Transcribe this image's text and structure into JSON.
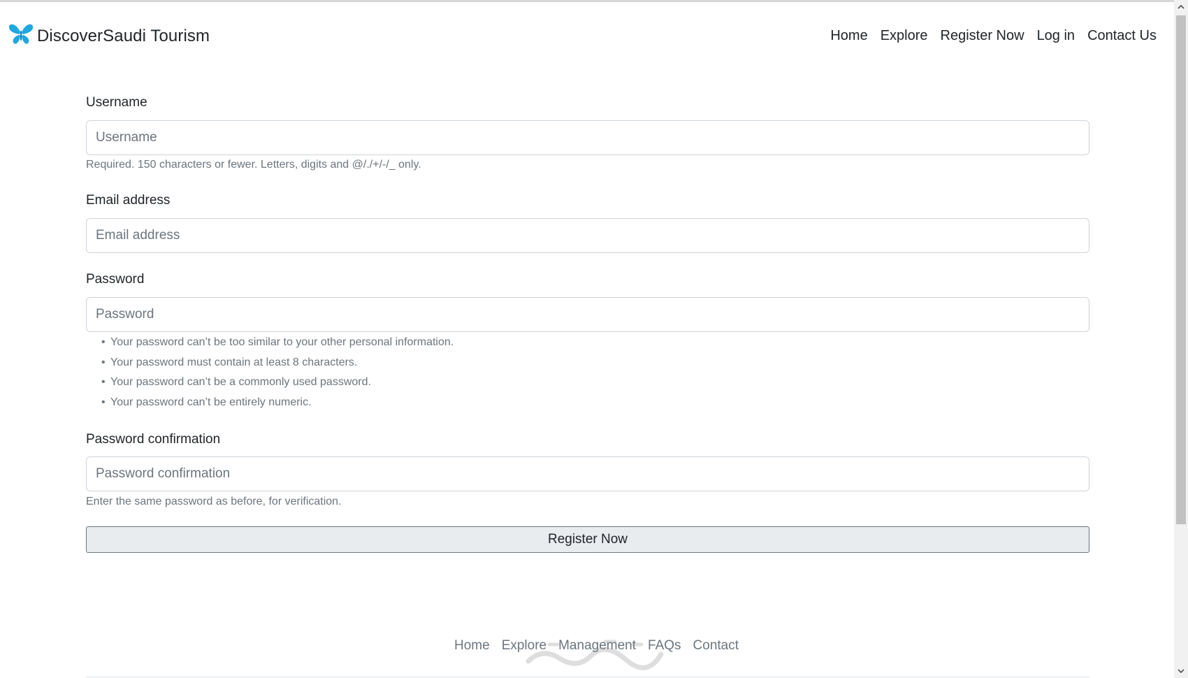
{
  "navbar": {
    "brand": "DiscoverSaudi Tourism",
    "links": [
      "Home",
      "Explore",
      "Register Now",
      "Log in",
      "Contact Us"
    ]
  },
  "form": {
    "username": {
      "label": "Username",
      "placeholder": "Username",
      "help": "Required. 150 characters or fewer. Letters, digits and @/./+/-/_ only."
    },
    "email": {
      "label": "Email address",
      "placeholder": "Email address"
    },
    "password": {
      "label": "Password",
      "placeholder": "Password",
      "hints": [
        "Your password can’t be too similar to your other personal information.",
        "Your password must contain at least 8 characters.",
        "Your password can’t be a commonly used password.",
        "Your password can’t be entirely numeric."
      ]
    },
    "password_confirmation": {
      "label": "Password confirmation",
      "placeholder": "Password confirmation",
      "help": "Enter the same password as before, for verification."
    },
    "submit_label": "Register Now"
  },
  "footer": {
    "links": [
      "Home",
      "Explore",
      "Management",
      "FAQs",
      "Contact"
    ]
  },
  "colors": {
    "brand_icon": "#1ea7e1",
    "text": "#212529",
    "muted": "#6c757d",
    "button_bg": "#e9ecef",
    "input_border": "#ced4da"
  },
  "icons": {
    "brand": "butterfly-icon",
    "watermark": "watermark-logo"
  }
}
